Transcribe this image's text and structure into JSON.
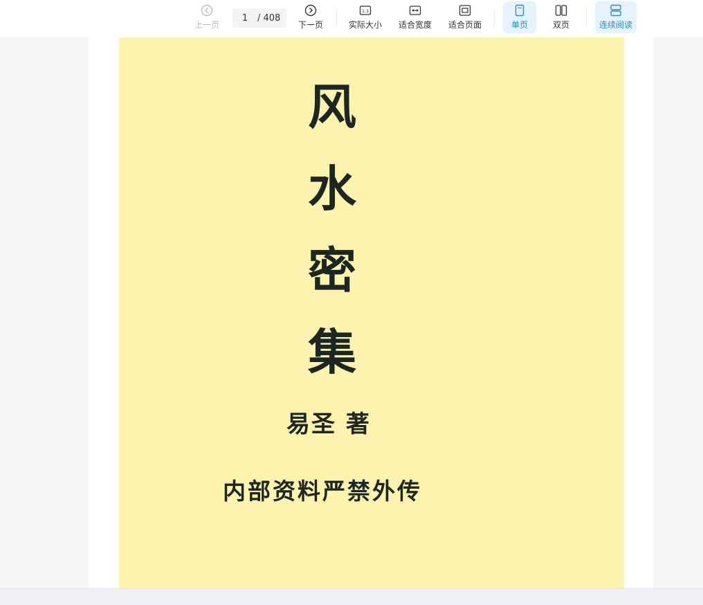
{
  "toolbar": {
    "prev_label": "上一页",
    "next_label": "下一页",
    "current_page": "1",
    "total_pages": "/ 408",
    "actual_size_label": "实际大小",
    "fit_width_label": "适合宽度",
    "fit_page_label": "适合页面",
    "single_page_label": "单页",
    "double_page_label": "双页",
    "continuous_label": "连续阅读",
    "accent_color": "#2b8ad6"
  },
  "document": {
    "title_chars": [
      "风",
      "水",
      "密",
      "集"
    ],
    "author": "易圣 著",
    "notice": "内部资料严禁外传",
    "page_color": "#fcf4ae"
  }
}
